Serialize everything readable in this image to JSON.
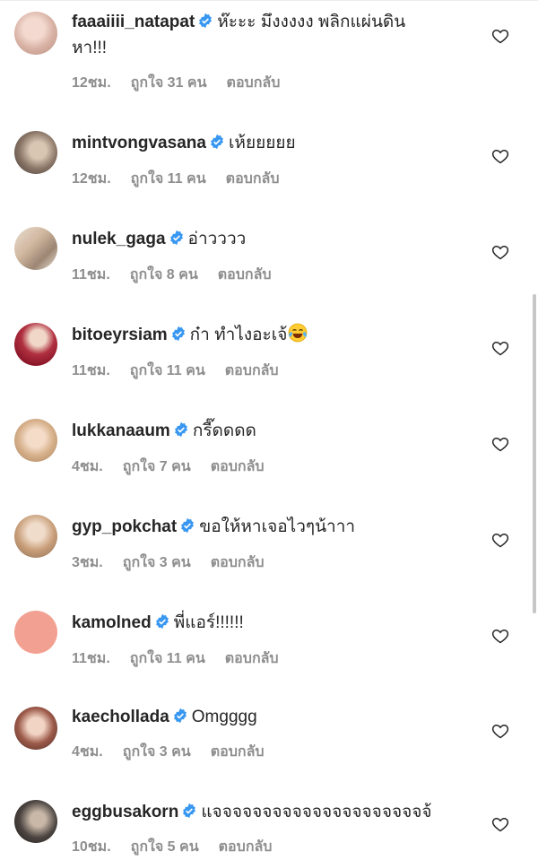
{
  "comments": [
    {
      "username": "faaaiiii_natapat",
      "text": "ห๊ะะะ มึงงงงง พลิกแผ่นดิน",
      "text2": "หา!!!",
      "time": "12ชม.",
      "likes": "ถูกใจ 31 คน",
      "reply": "ตอบกลับ"
    },
    {
      "username": "mintvongvasana",
      "text": "เห้ยยยยย",
      "time": "12ชม.",
      "likes": "ถูกใจ 11 คน",
      "reply": "ตอบกลับ"
    },
    {
      "username": "nulek_gaga",
      "text": "อ่าวววว",
      "time": "11ชม.",
      "likes": "ถูกใจ 8 คน",
      "reply": "ตอบกลับ"
    },
    {
      "username": "bitoeyrsiam",
      "text": "ก๋า ทำไงอะเจ้",
      "emoji": "tears-of-joy-emoji",
      "time": "11ชม.",
      "likes": "ถูกใจ 11 คน",
      "reply": "ตอบกลับ"
    },
    {
      "username": "lukkanaaum",
      "text": "กรี๊ดดดด",
      "time": "4ชม.",
      "likes": "ถูกใจ 7 คน",
      "reply": "ตอบกลับ"
    },
    {
      "username": "gyp_pokchat",
      "text": "ขอให้หาเจอไวๆน้าาา",
      "time": "3ชม.",
      "likes": "ถูกใจ 3 คน",
      "reply": "ตอบกลับ"
    },
    {
      "username": "kamolned",
      "text": "พี่แอร์!!!!!!",
      "time": "11ชม.",
      "likes": "ถูกใจ 11 คน",
      "reply": "ตอบกลับ"
    },
    {
      "username": "kaechollada",
      "text": "Omgggg",
      "time": "4ชม.",
      "likes": "ถูกใจ 3 คน",
      "reply": "ตอบกลับ"
    },
    {
      "username": "eggbusakorn",
      "text": "แจจจจจจจจจจจจจจจจจจจจจจ้",
      "time": "10ชม.",
      "likes": "ถูกใจ 5 คน",
      "reply": "ตอบกลับ"
    }
  ],
  "colors": {
    "verified": "#3897f0",
    "text": "#262626",
    "meta": "#8e8e8e",
    "kamolned_avatar": "#f2a091"
  },
  "icons": {
    "verified": "verified-badge-icon",
    "like": "heart-outline-icon"
  }
}
